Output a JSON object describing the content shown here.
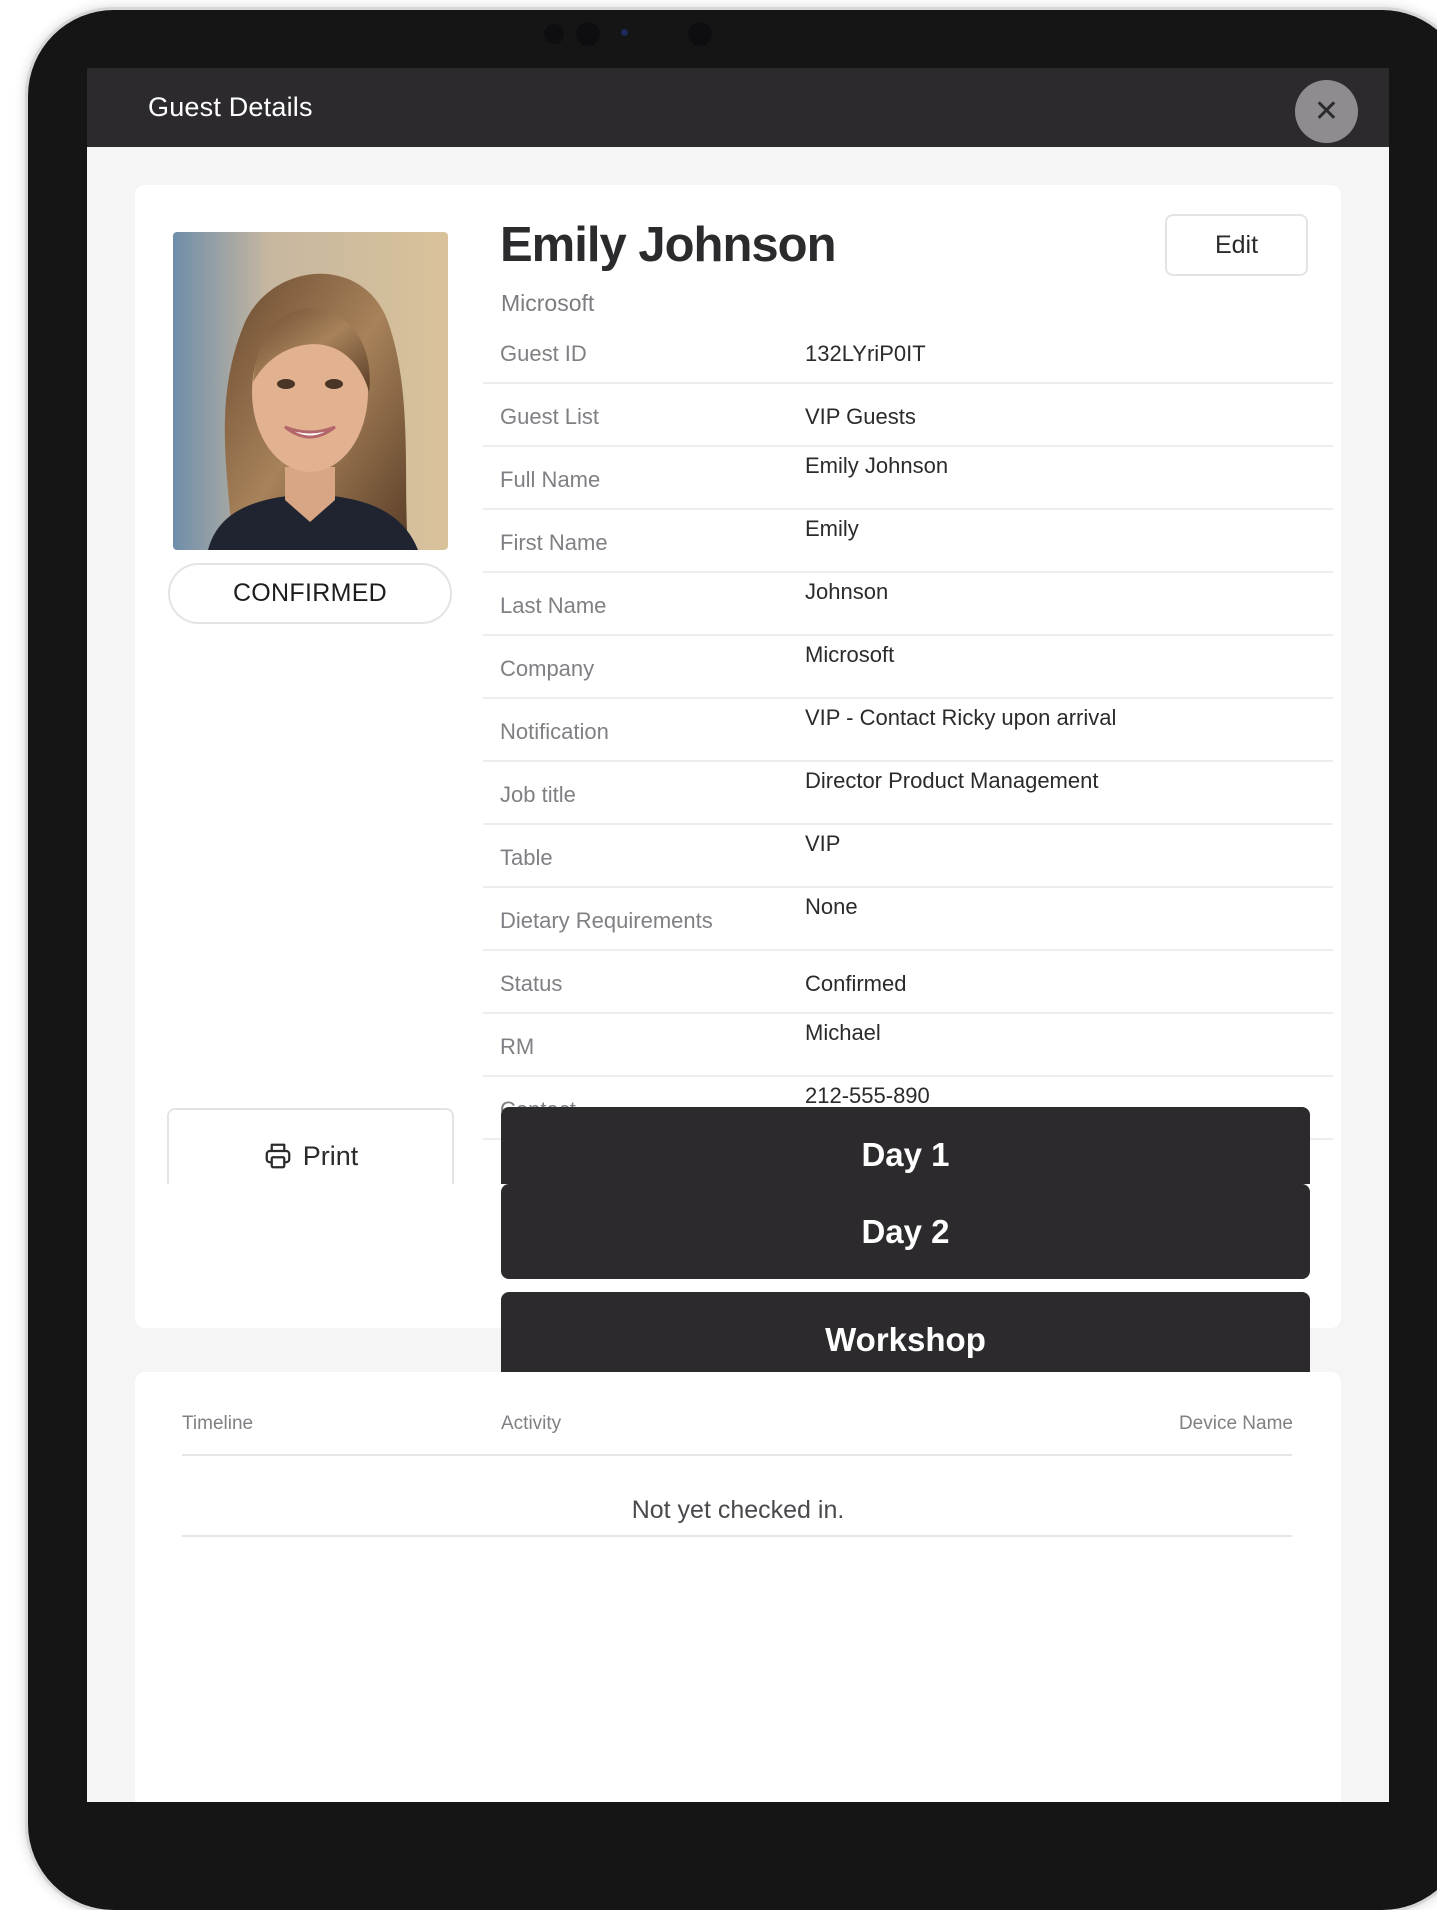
{
  "modal": {
    "title": "Guest Details"
  },
  "guest": {
    "name": "Emily Johnson",
    "company": "Microsoft",
    "status_badge": "CONFIRMED",
    "edit_label": "Edit"
  },
  "details": [
    {
      "label": "Guest ID",
      "value": "132LYriP0IT"
    },
    {
      "label": "Guest List",
      "value": "VIP Guests"
    },
    {
      "label": "Full Name",
      "value": "Emily Johnson"
    },
    {
      "label": "First Name",
      "value": "Emily"
    },
    {
      "label": "Last Name",
      "value": "Johnson"
    },
    {
      "label": "Company",
      "value": "Microsoft"
    },
    {
      "label": "Notification",
      "value": "VIP - Contact Ricky upon arrival"
    },
    {
      "label": "Job title",
      "value": "Director Product Management"
    },
    {
      "label": "Table",
      "value": "VIP"
    },
    {
      "label": "Dietary Requirements",
      "value": "None"
    },
    {
      "label": "Status",
      "value": "Confirmed"
    },
    {
      "label": "RM",
      "value": "Michael"
    },
    {
      "label": "Contact",
      "value": "212-555-890"
    }
  ],
  "actions": {
    "print_label": "Print",
    "sessions": [
      "Day 1",
      "Day 2",
      "Workshop"
    ]
  },
  "timeline": {
    "columns": [
      "Timeline",
      "Activity",
      "Device Name"
    ],
    "empty_message": "Not yet checked in."
  }
}
